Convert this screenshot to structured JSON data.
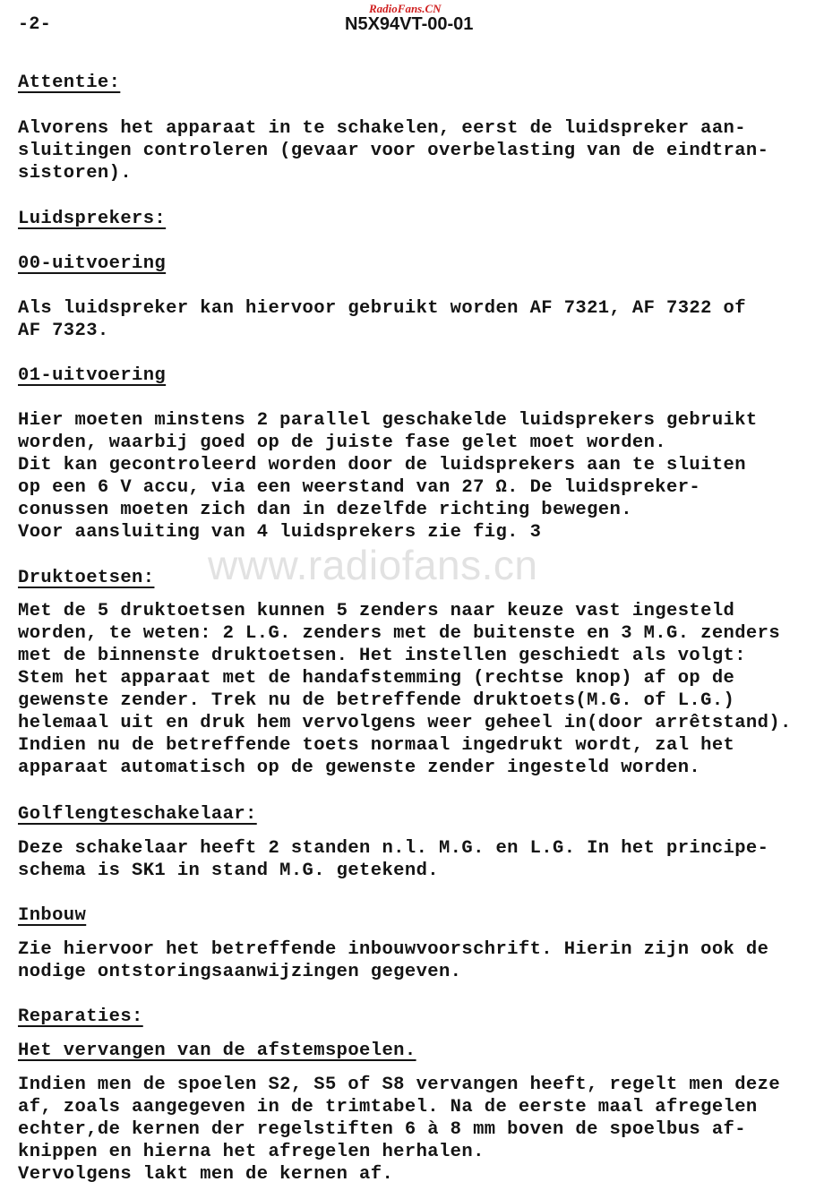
{
  "header": {
    "page_number": "-2-",
    "document_id": "N5X94VT-00-01",
    "site_overlay": "RadioFans.CN"
  },
  "watermark": "www.radiofans.cn",
  "sections": {
    "attentie": {
      "heading": "Attentie:",
      "lines": [
        "Alvorens het apparaat in te schakelen, eerst de luidspreker aan-",
        "sluitingen controleren (gevaar voor overbelasting van de eindtran-",
        "sistoren)."
      ]
    },
    "luidsprekers": {
      "heading": "Luidsprekers:"
    },
    "uitvoering_00": {
      "heading": "00-uitvoering",
      "lines": [
        "Als luidspreker kan hiervoor gebruikt worden AF 7321, AF 7322 of",
        "AF 7323."
      ]
    },
    "uitvoering_01": {
      "heading": "01-uitvoering",
      "lines": [
        "Hier moeten minstens 2 parallel geschakelde luidsprekers gebruikt",
        "worden, waarbij goed op de juiste fase gelet moet worden.",
        "Dit kan gecontroleerd worden door de luidsprekers aan te sluiten",
        "op een 6 V accu, via een weerstand van 27 Ω. De luidspreker-",
        "conussen moeten zich dan in dezelfde richting bewegen.",
        "Voor aansluiting van 4 luidsprekers zie fig. 3"
      ]
    },
    "druktoetsen": {
      "heading": "Druktoetsen:",
      "lines": [
        "Met de 5 druktoetsen kunnen 5 zenders naar keuze vast ingesteld",
        "worden, te weten: 2 L.G. zenders met de buitenste en 3 M.G. zenders",
        "met de binnenste druktoetsen. Het instellen geschiedt als volgt:",
        "Stem het apparaat met de handafstemming (rechtse knop) af op de",
        "gewenste zender. Trek nu de betreffende druktoets(M.G. of L.G.)",
        "helemaal uit en druk hem vervolgens weer geheel in(door arrêtstand).",
        "Indien nu de betreffende toets normaal ingedrukt wordt, zal het",
        "apparaat automatisch op de gewenste zender ingesteld worden."
      ]
    },
    "golflengteschakelaar": {
      "heading": "Golflengteschakelaar:",
      "lines": [
        "Deze schakelaar heeft 2 standen n.l. M.G. en L.G. In het principe-",
        "schema is SK1 in stand M.G. getekend."
      ]
    },
    "inbouw": {
      "heading": "Inbouw",
      "lines": [
        "Zie hiervoor het betreffende inbouwvoorschrift. Hierin zijn ook de",
        "nodige ontstoringsaanwijzingen gegeven."
      ]
    },
    "reparaties": {
      "heading": "Reparaties:"
    },
    "afstemspoelen": {
      "heading": "Het vervangen van de afstemspoelen.",
      "lines": [
        "Indien men de spoelen S2, S5 of S8 vervangen heeft, regelt men deze",
        "af, zoals aangegeven in de trimtabel. Na de eerste maal afregelen",
        "echter,de kernen der regelstiften 6 à 8 mm boven de spoelbus af-",
        "knippen en hierna het afregelen herhalen.",
        "Vervolgens lakt men de kernen af."
      ]
    }
  }
}
